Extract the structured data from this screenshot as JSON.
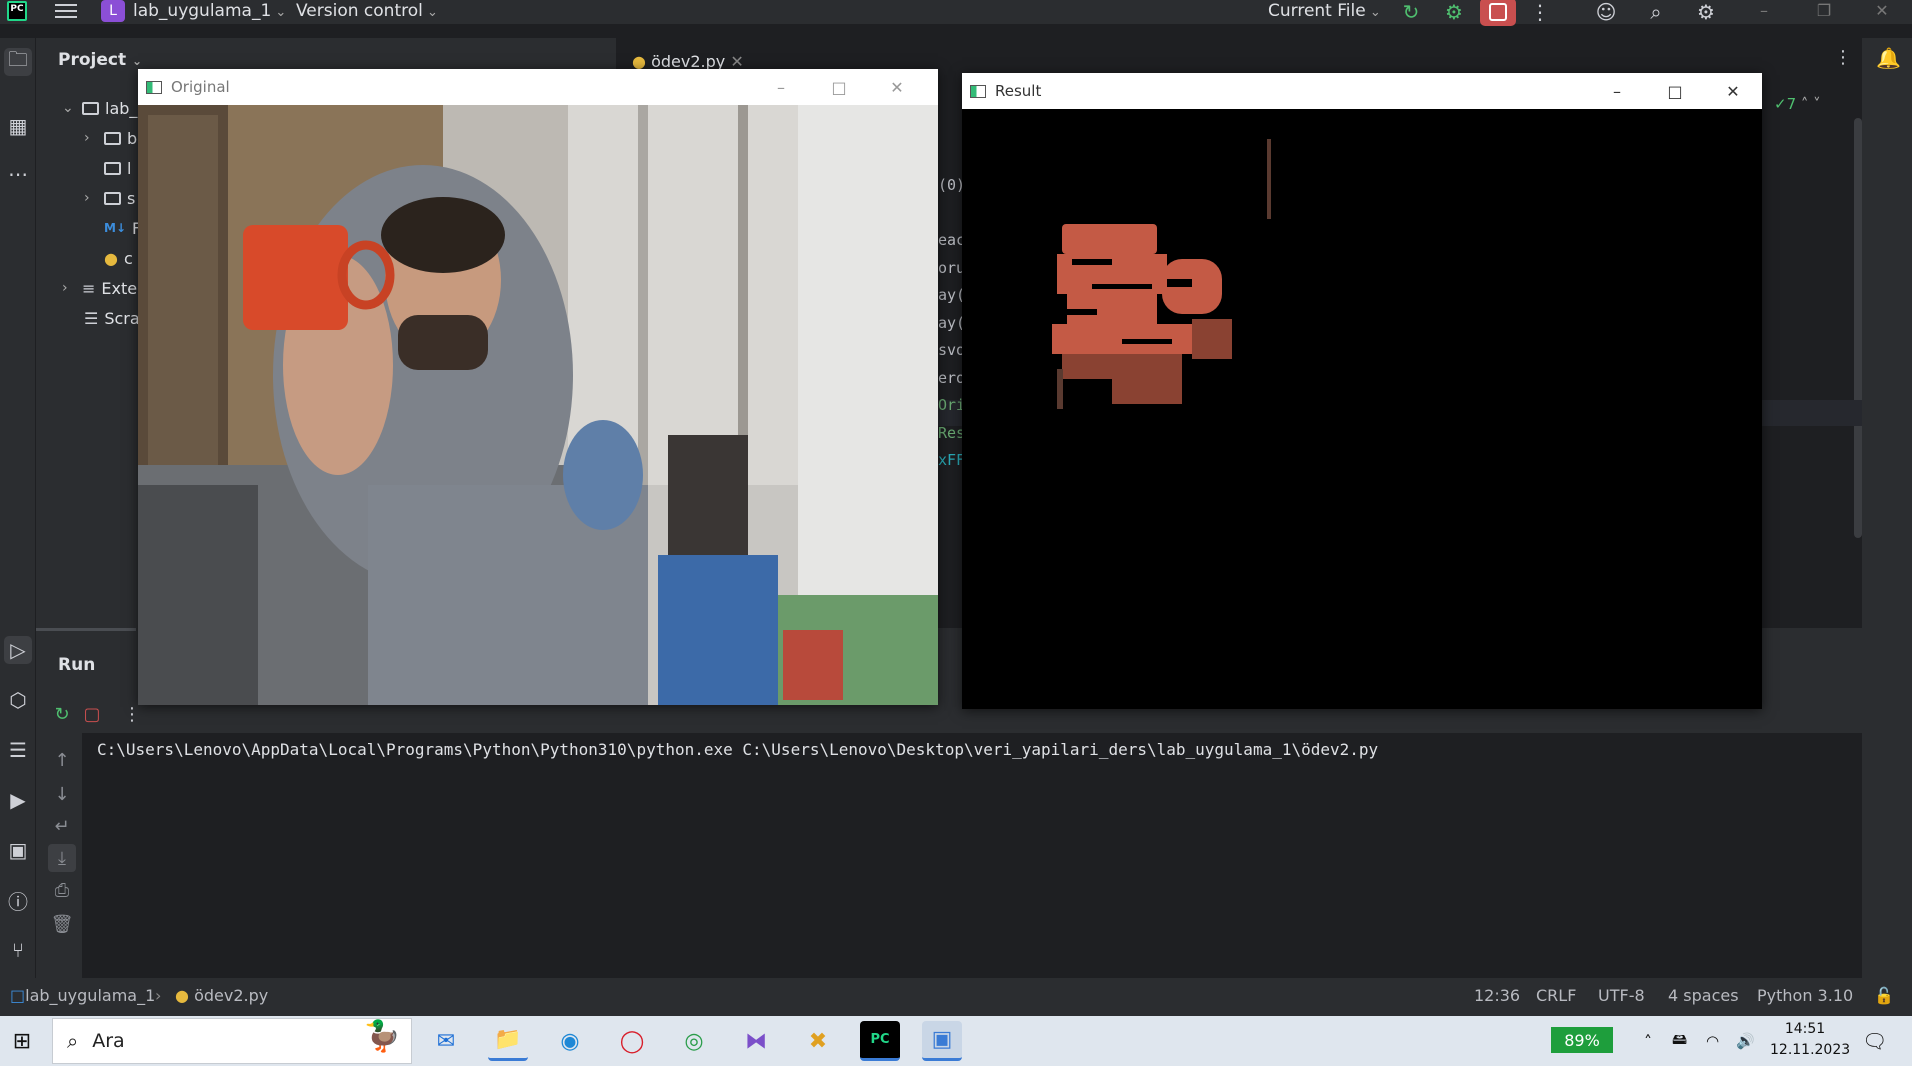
{
  "ide": {
    "project_name": "lab_uygulama_1",
    "project_badge": "L",
    "version_control": "Version control",
    "run_config": "Current File",
    "logo": "PC"
  },
  "project_panel": {
    "title": "Project",
    "root": "lab_",
    "items": [
      "b",
      "l",
      "s",
      "F",
      "c"
    ],
    "external": "Exte",
    "scratches": "Scra"
  },
  "editor": {
    "tab_file": "ödev2.py",
    "inspections_count": "7",
    "code_fragments": [
      "(0)",
      "eac",
      "oru",
      "ay(",
      "ay(",
      "svo",
      "ero",
      "Ori",
      "Res",
      "xFF"
    ]
  },
  "run_panel": {
    "label": "Run",
    "console_line": "C:\\Users\\Lenovo\\AppData\\Local\\Programs\\Python\\Python310\\python.exe C:\\Users\\Lenovo\\Desktop\\veri_yapilari_ders\\lab_uygulama_1\\ödev2.py"
  },
  "statusbar": {
    "project": "lab_uygulama_1",
    "file": "ödev2.py",
    "position": "12:36",
    "line_sep": "CRLF",
    "encoding": "UTF-8",
    "indent": "4 spaces",
    "interpreter": "Python 3.10"
  },
  "windows": {
    "original_title": "Original",
    "result_title": "Result"
  },
  "taskbar": {
    "search_placeholder": "Ara",
    "battery": "89%",
    "time": "14:51",
    "date": "12.11.2023"
  },
  "colors": {
    "ide_bg": "#1e1f22",
    "panel_bg": "#2b2d30",
    "accent_stop": "#c94f4f",
    "run_green": "#4fbf6f",
    "battery_green": "#1e9e3c"
  }
}
